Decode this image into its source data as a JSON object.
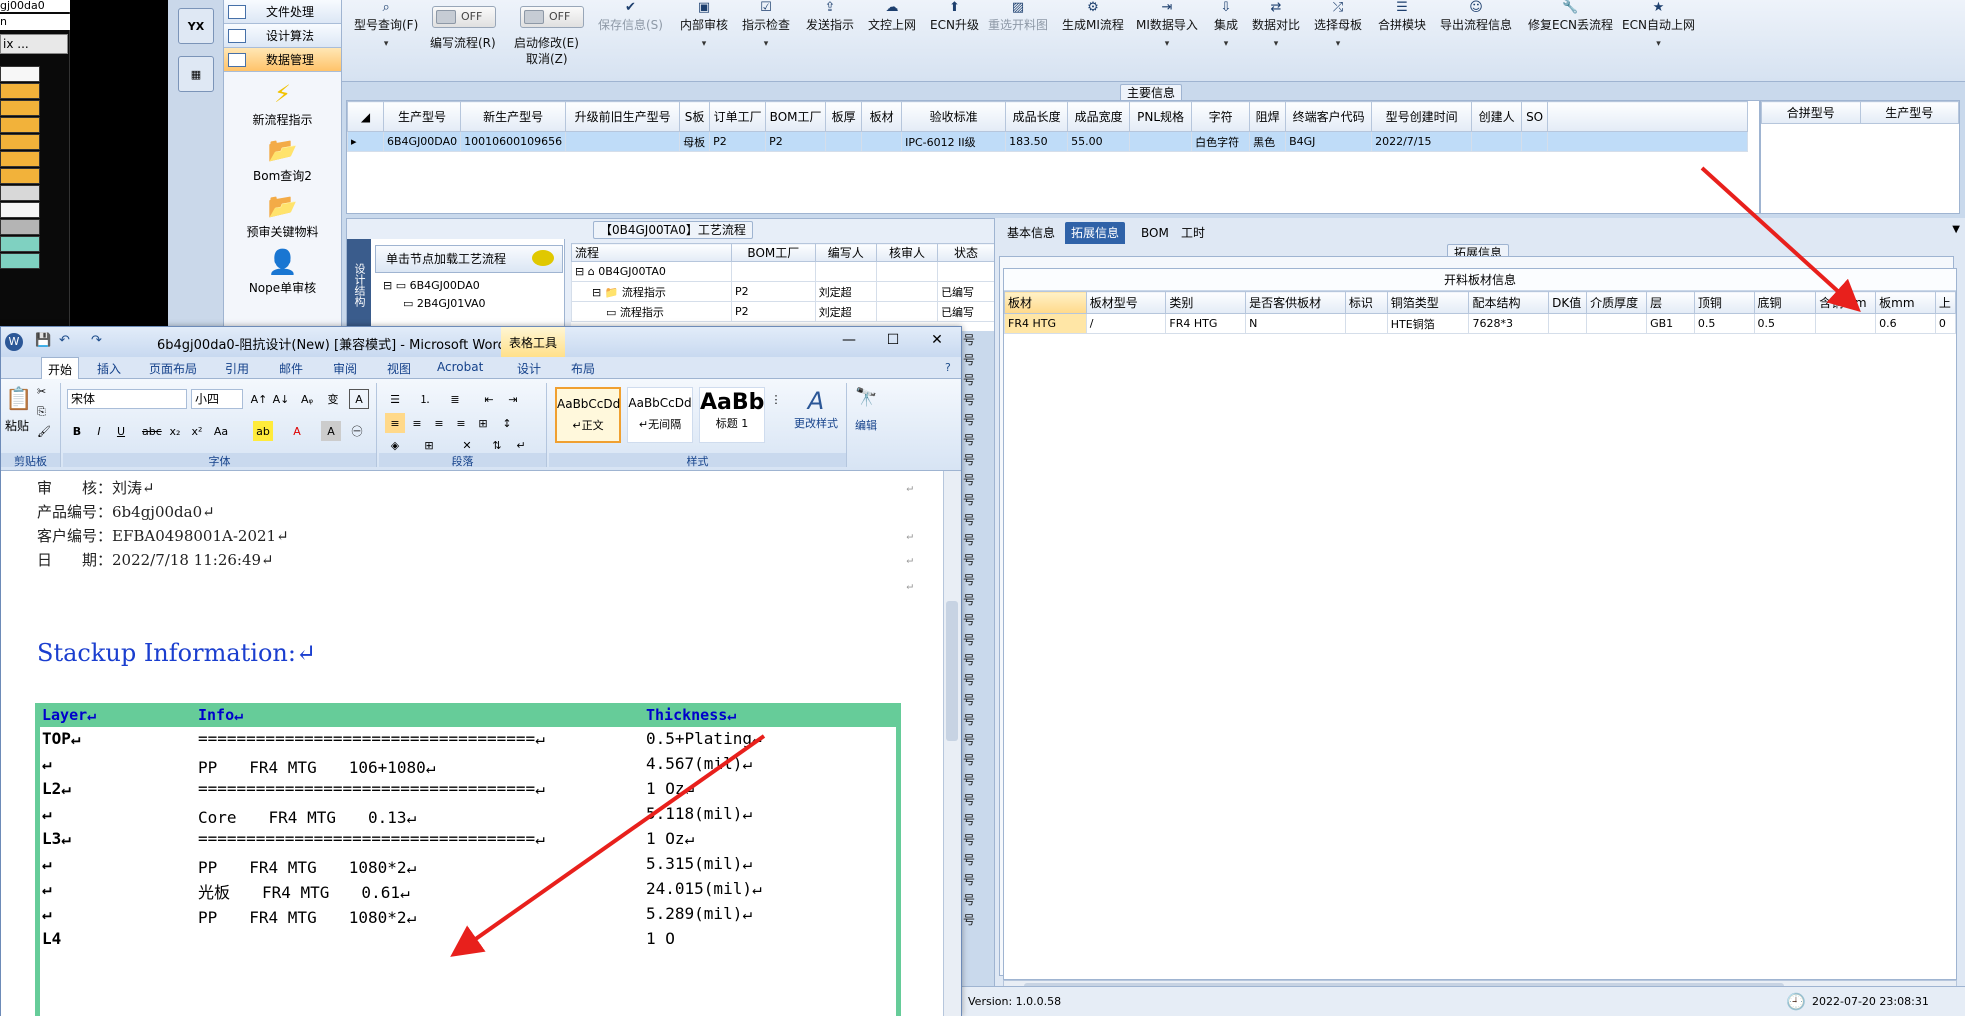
{
  "left_app": {
    "title": "gj00da0",
    "subtitle": "n",
    "button": "ix ..."
  },
  "nav_strip": {
    "top_icon": "YX"
  },
  "side_nav": {
    "headers": [
      "文件处理",
      "设计算法",
      "数据管理"
    ],
    "items": [
      "新流程指示",
      "Bom查询2",
      "预审关键物料",
      "Nope单审核"
    ]
  },
  "toolbar": {
    "model_query": "型号查询(F)",
    "write_flow": "编写流程(R)",
    "start_modify": "启动修改(E)",
    "cancel": "取消(Z)",
    "toggle_text": "OFF",
    "save_info": "保存信息(S)",
    "buttons": [
      "内部审核",
      "指示检查",
      "发送指示",
      "文控上网",
      "ECN升级",
      "重选开料图",
      "生成MI流程",
      "MI数据导入",
      "集成",
      "数据对比",
      "选择母板",
      "合拼模块",
      "导出流程信息",
      "修复ECN丢流程",
      "ECN自动上网"
    ]
  },
  "main_info": {
    "label": "主要信息",
    "columns": [
      "生产型号",
      "新生产型号",
      "升级前旧生产型号",
      "S板",
      "订单工厂",
      "BOM工厂",
      "板厚",
      "板材",
      "验收标准",
      "成品长度",
      "成品宽度",
      "PNL规格",
      "字符",
      "阻焊",
      "终端客户代码",
      "型号创建时间",
      "创建人",
      "SO"
    ],
    "row": [
      "6B4GJ00DA0",
      "10010600109656",
      "",
      "母板",
      "P2",
      "P2",
      "",
      "",
      "IPC-6012 II级",
      "183.50",
      "55.00",
      "",
      "白色字符",
      "黑色",
      "B4GJ",
      "2022/7/15",
      "",
      ""
    ]
  },
  "merge_panel": {
    "columns": [
      "合拼型号",
      "生产型号"
    ]
  },
  "process": {
    "title": "【0B4GJ00TA0】工艺流程",
    "vertical_label": "设计结构",
    "load_button": "单击节点加载工艺流程",
    "tree": [
      "6B4GJ00DA0",
      "2B4GJ01VA0"
    ],
    "columns": [
      "流程",
      "BOM工厂",
      "编写人",
      "核审人",
      "状态"
    ],
    "rows": [
      [
        "0B4GJ00TA0",
        "",
        "",
        "",
        ""
      ],
      [
        "流程指示",
        "P2",
        "刘定超",
        "",
        "已编写"
      ],
      [
        "流程指示",
        "P2",
        "刘定超",
        "",
        "已编写"
      ]
    ],
    "status_col": [
      "号",
      "号",
      "号",
      "号",
      "号",
      "号",
      "号",
      "号",
      "号",
      "号",
      "号",
      "号",
      "号",
      "号",
      "号",
      "号",
      "号",
      "号",
      "号",
      "号",
      "号",
      "号",
      "号",
      "号",
      "号",
      "号",
      "号",
      "号",
      "号",
      "号"
    ]
  },
  "right_panel": {
    "tabs": [
      "基本信息",
      "拓展信息",
      "BOM",
      "工时"
    ],
    "group_label": "拓展信息",
    "section_title": "开料板材信息",
    "columns": [
      "板材",
      "板材型号",
      "类别",
      "是否客供板材",
      "标识",
      "铜箔类型",
      "配本结构",
      "DK值",
      "介质厚度",
      "层",
      "顶铜",
      "底铜",
      "含铜mm",
      "板mm",
      "上"
    ],
    "row": [
      "FR4 HTG",
      "/",
      "FR4 HTG",
      "N",
      "",
      "HTE铜箔",
      "7628*3",
      "",
      "",
      "GB1",
      "0.5",
      "0.5",
      "",
      "0.6",
      "0"
    ]
  },
  "status_bar": {
    "version": "Version: 1.0.0.58",
    "datetime": "2022-07-20 23:08:31"
  },
  "word": {
    "title": "6b4gj00da0-阻抗设计(New) [兼容模式] - Microsoft Word",
    "context_tab": "表格工具",
    "tabs": [
      "开始",
      "插入",
      "页面布局",
      "引用",
      "邮件",
      "审阅",
      "视图",
      "Acrobat",
      "设计",
      "布局"
    ],
    "font_name": "宋体",
    "font_size": "小四",
    "group_labels": [
      "剪贴板",
      "字体",
      "段落",
      "样式",
      "编辑"
    ],
    "paste_label": "粘贴",
    "styles": [
      {
        "preview": "AaBbCcDd",
        "name": "↵正文"
      },
      {
        "preview": "AaBbCcDd",
        "name": "↵无间隔"
      },
      {
        "preview": "AaBb",
        "name": "标题 1"
      }
    ],
    "change_style": "更改样式",
    "edit": "编辑",
    "doc": {
      "lines": [
        "审　　核：刘涛↵",
        "产品编号：6b4gj00da0↵",
        "客户编号：EFBA0498001A-2021↵",
        "日　　期：2022/7/18 11:26:49↵"
      ],
      "stack_title": "Stackup Information:↵",
      "headers": [
        "Layer↵",
        "Info↵",
        "Thickness↵"
      ],
      "rows": [
        [
          "TOP↵",
          "===================================↵",
          "0.5+Plating↵"
        ],
        [
          "↵",
          "PP　　FR4 MTG　　106+1080↵",
          "4.567(mil)↵"
        ],
        [
          "L2↵",
          "===================================↵",
          "1 Oz↵"
        ],
        [
          "↵",
          "Core　　FR4 MTG　　0.13↵",
          "5.118(mil)↵"
        ],
        [
          "L3↵",
          "===================================↵",
          "1 Oz↵"
        ],
        [
          "↵",
          "PP　　FR4 MTG　　1080*2↵",
          "5.315(mil)↵"
        ],
        [
          "↵",
          "光板　　FR4 MTG　　0.61↵",
          "24.015(mil)↵"
        ],
        [
          "↵",
          "PP　　FR4 MTG　　1080*2↵",
          "5.289(mil)↵"
        ],
        [
          "L4",
          "",
          "1 O"
        ]
      ]
    }
  },
  "colors": {
    "arrow": "#e8201c",
    "stack_green": "#66cc99",
    "title_blue": "#1a3ecf"
  }
}
